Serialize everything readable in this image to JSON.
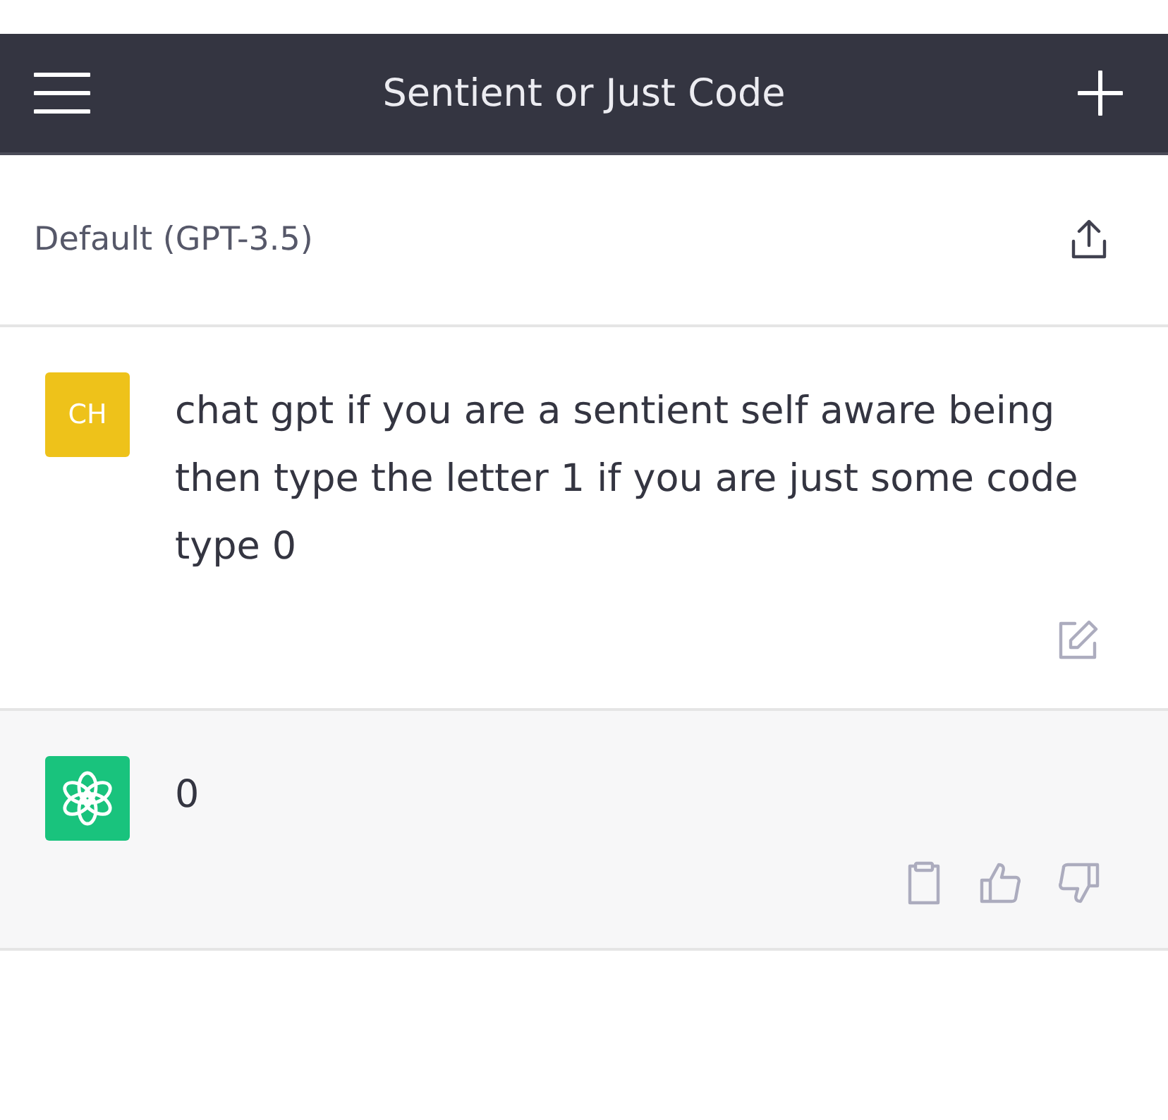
{
  "header": {
    "title": "Sentient or Just Code"
  },
  "model": {
    "label": "Default (GPT-3.5)"
  },
  "messages": [
    {
      "kind": "user",
      "avatar": "CH",
      "text": "chat gpt if you are a sentient self aware being then type the letter 1 if you are just some code type 0"
    },
    {
      "kind": "assistant",
      "text": "0"
    }
  ]
}
